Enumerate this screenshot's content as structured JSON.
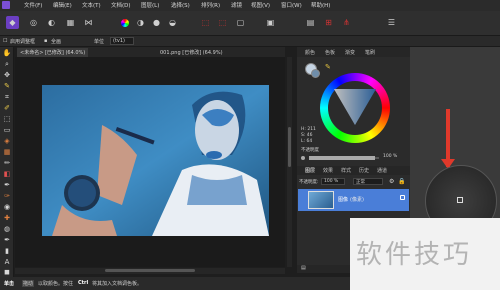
{
  "menu": {
    "file": "文件(F)",
    "edit": "编辑(E)",
    "text": "文本(T)",
    "document": "文档(D)",
    "layer": "图层(L)",
    "select": "选择(S)",
    "arrange": "排列(R)",
    "filters": "滤镜",
    "view": "视图(V)",
    "window": "窗口(W)",
    "help": "帮助(H)"
  },
  "context": {
    "link_label": "启用调整框",
    "layer_label": "全画",
    "unit_label": "单位",
    "unit_value": "(tv1)"
  },
  "tabs": [
    {
      "label": "<未命名> [已修改] (64.0%)"
    },
    {
      "label": "001.png [已修改] (64.9%)"
    }
  ],
  "right_panel": {
    "tabs": [
      "颜色",
      "色板",
      "渐变",
      "笔刷"
    ],
    "hsl": {
      "h": "H: 211",
      "s": "S: 46",
      "l": "L: 64"
    },
    "opacity_label": "不透明度",
    "opacity_value": "100 %",
    "layer_tabs": [
      "图层",
      "效果",
      "样式",
      "历史",
      "通道"
    ],
    "blend_opacity_label": "不透明度:",
    "blend_opacity_value": "100 %",
    "blend_mode": "正常",
    "layer_name": "(像素)",
    "layer_label_prefix": "图像"
  },
  "status": {
    "prefix": "单击",
    "mode": "拖动",
    "text1": "以取颜色。按住",
    "key": "Ctrl",
    "text2": "将其加入文档调色板。"
  },
  "watermark": {
    "text": "软件技巧"
  },
  "colors": {
    "accent": "#4a90e2",
    "photo_bg": "#2e6fa0",
    "red_arrow": "#e0392b"
  }
}
